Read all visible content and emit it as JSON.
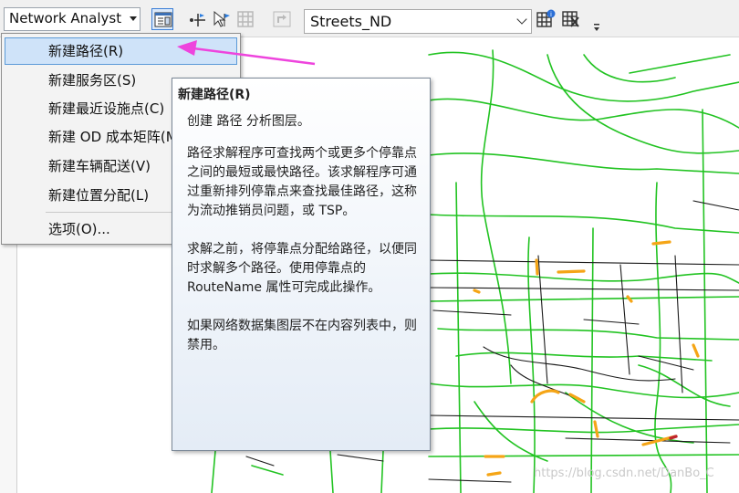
{
  "toolbar": {
    "network_analyst_label": "Network Analyst",
    "network_dataset": "Streets_ND"
  },
  "menu": {
    "items": [
      {
        "label": "新建路径(R)",
        "highlighted": true
      },
      {
        "label": "新建服务区(S)"
      },
      {
        "label": "新建最近设施点(C)"
      },
      {
        "label": "新建 OD 成本矩阵(M)"
      },
      {
        "label": "新建车辆配送(V)"
      },
      {
        "label": "新建位置分配(L)"
      },
      {
        "label": "选项(O)..."
      }
    ]
  },
  "tooltip": {
    "title": "新建路径(R)",
    "description": "创建 路径 分析图层。",
    "p1": "路径求解程序可查找两个或更多个停靠点之间的最短或最快路径。该求解程序可通过重新排列停靠点来查找最佳路径，这称为流动推销员问题，或 TSP。",
    "p2": "求解之前，将停靠点分配给路径，以便同时求解多个路径。使用停靠点的 RouteName 属性可完成此操作。",
    "p3": "如果网络数据集图层不在内容列表中，则禁用。"
  },
  "colors": {
    "road_green": "#22c322",
    "road_black": "#1a1a1a",
    "road_orange": "#f5a516",
    "highlight_blue": "#cfe3f9",
    "arrow_magenta": "#ee44dd"
  },
  "watermark": "https://blog.csdn.net/DanBo_C"
}
